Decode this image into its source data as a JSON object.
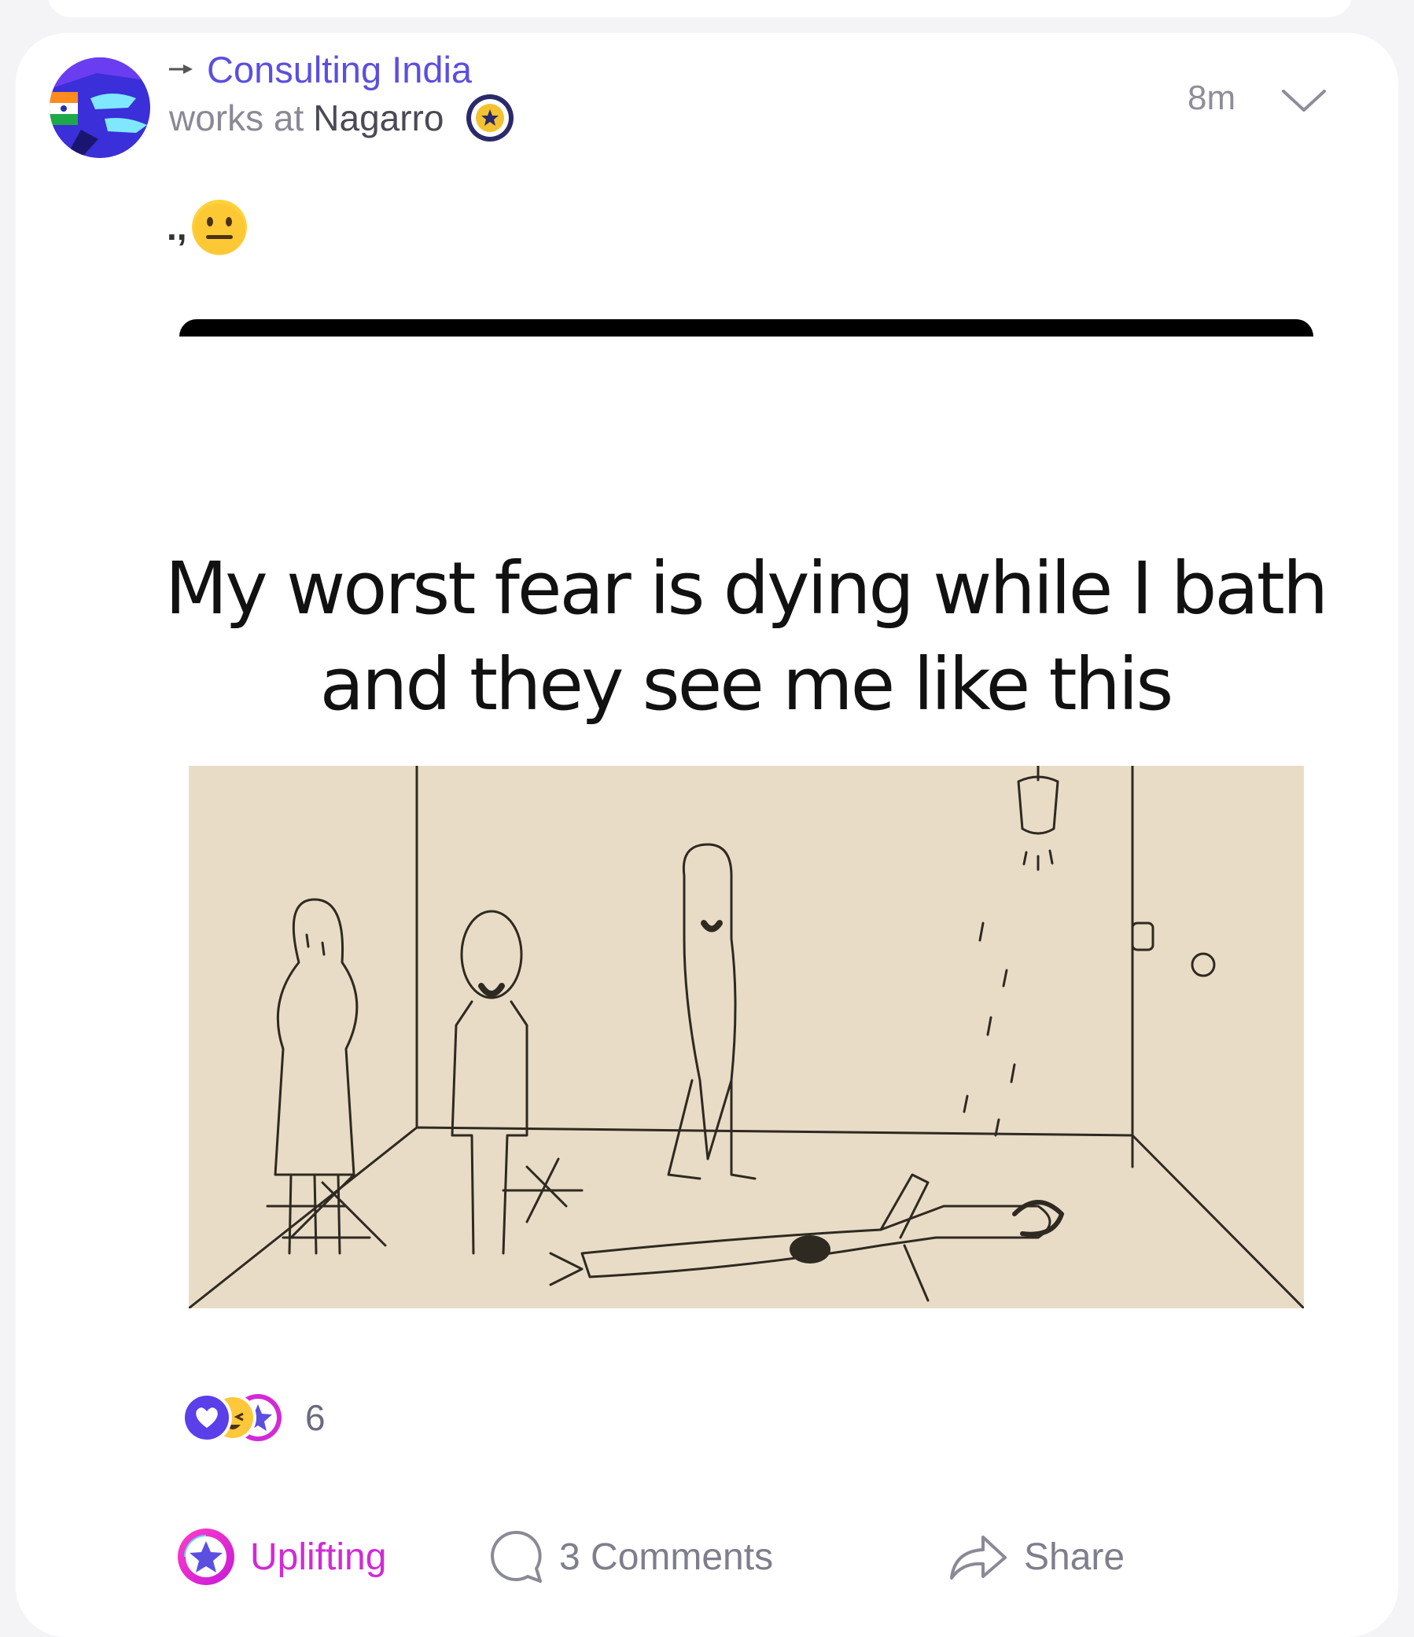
{
  "post": {
    "channel": "Consulting India",
    "works_at_label": "works at",
    "company": "Nagarro",
    "time": "8m",
    "text_prefix": ".,",
    "emoji": "neutral-face"
  },
  "meme": {
    "caption_line1": "My worst fear is dying while I bath",
    "caption_line2": "and they see me like this"
  },
  "reactions": {
    "count": "6",
    "types": [
      "heart",
      "laughing",
      "uplifting"
    ]
  },
  "actions": {
    "uplifting_label": "Uplifting",
    "comments_label": "3 Comments",
    "share_label": "Share"
  },
  "colors": {
    "channel": "#5b4fe0",
    "uplifting": "#d22ad6",
    "muted": "#8a8a96"
  }
}
